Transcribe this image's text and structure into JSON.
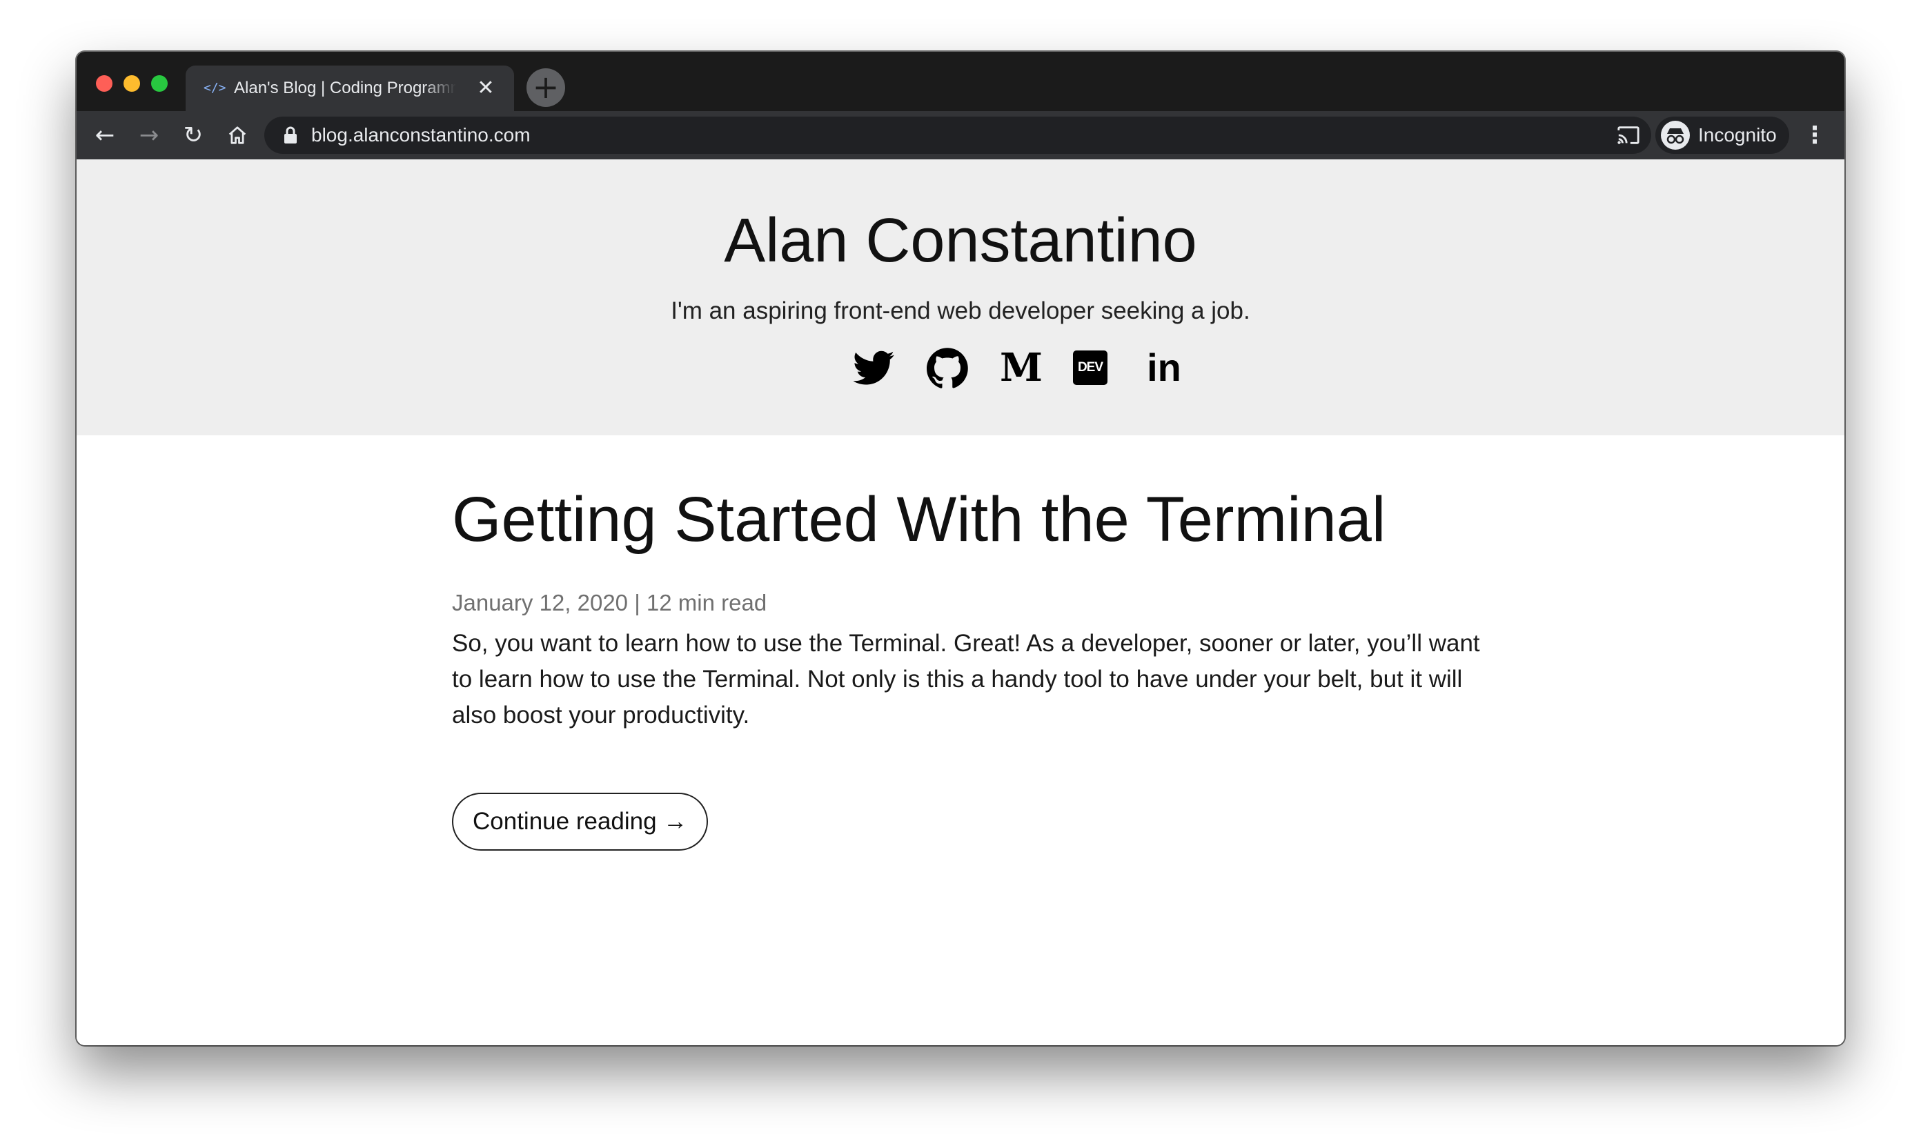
{
  "browser": {
    "tab": {
      "favicon": "</>",
      "title": "Alan's Blog | Coding Programming",
      "close": "✕"
    },
    "new_tab": "+",
    "toolbar": {
      "back": "←",
      "forward": "→",
      "reload": "↻",
      "home": "⌂",
      "url": "blog.alanconstantino.com",
      "bookmark": "☆",
      "profile_label": "Incognito",
      "menu": "⋮"
    }
  },
  "hero": {
    "title": "Alan Constantino",
    "tagline": "I'm an aspiring front-end web developer seeking a job.",
    "social_links": [
      {
        "name": "twitter-icon"
      },
      {
        "name": "github-icon"
      },
      {
        "name": "medium-icon",
        "glyph": "M"
      },
      {
        "name": "dev-icon",
        "glyph": "DEV"
      },
      {
        "name": "linkedin-icon",
        "glyph": "in"
      }
    ]
  },
  "post": {
    "title": "Getting Started With the Terminal",
    "meta": "January 12, 2020 | 12 min read",
    "excerpt": "So, you want to learn how to use the Terminal. Great! As a developer, sooner or later, you’ll want to learn how to use the Terminal. Not only is this a handy tool to have under your belt, but it will also boost your productivity.",
    "cta": "Continue reading →"
  }
}
